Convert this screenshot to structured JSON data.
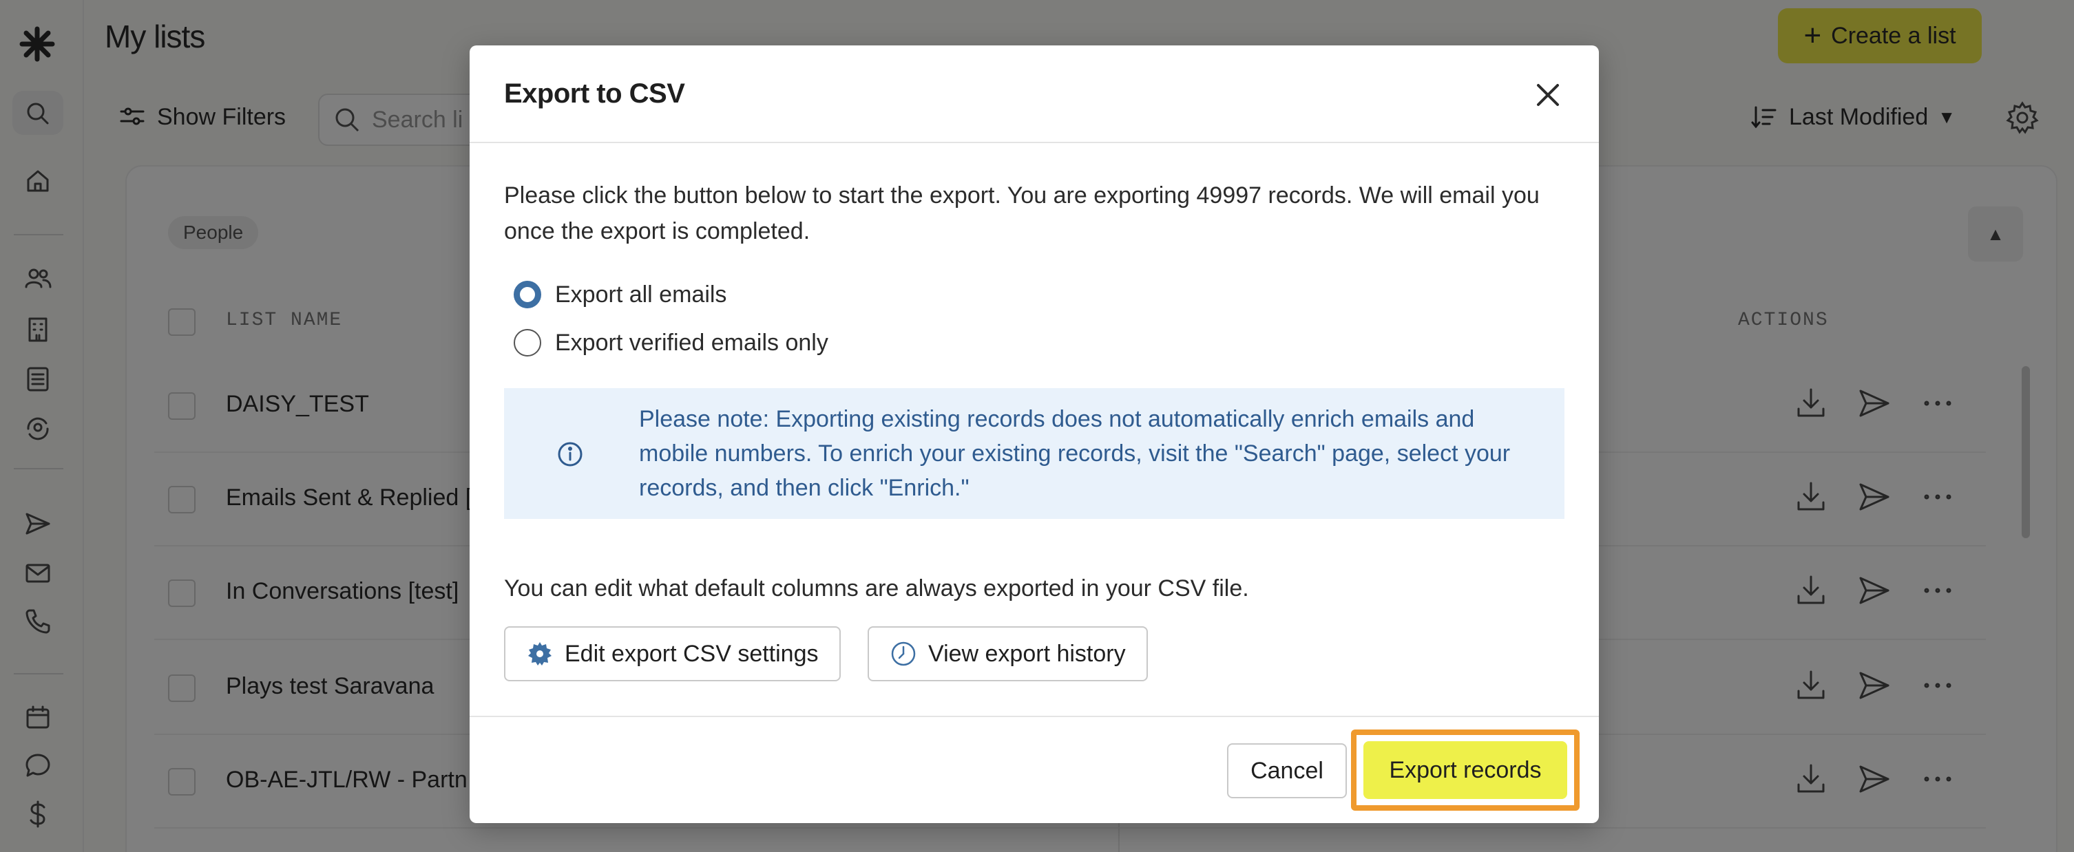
{
  "app": {
    "page_title": "My lists",
    "create_button": "Create a list",
    "show_filters": "Show Filters",
    "search_placeholder": "Search li",
    "sort_label": "Last Modified",
    "chip": "People",
    "columns": {
      "list_name": "LIST NAME",
      "actions": "ACTIONS"
    },
    "rows": [
      {
        "name": "DAISY_TEST"
      },
      {
        "name": "Emails Sent & Replied ["
      },
      {
        "name": "In Conversations [test]"
      },
      {
        "name": "Plays test Saravana"
      },
      {
        "name": "OB-AE-JTL/RW - Partn"
      }
    ]
  },
  "modal": {
    "title": "Export to CSV",
    "intro": "Please click the button below to start the export. You are exporting 49997 records. We will email you once the export is completed.",
    "options": [
      {
        "label": "Export all emails",
        "checked": true
      },
      {
        "label": "Export verified emails only",
        "checked": false
      }
    ],
    "note": "Please note: Exporting existing records does not automatically enrich emails and mobile numbers. To enrich your existing records, visit the \"Search\" page, select your records, and then click \"Enrich.\"",
    "edit_text": "You can edit what default columns are always exported in your CSV file.",
    "edit_settings_button": "Edit export CSV settings",
    "history_button": "View export history",
    "cancel_button": "Cancel",
    "export_button": "Export records"
  },
  "colors": {
    "accent_yellow": "#eef04a",
    "highlight_orange": "#ef9a2e",
    "info_blue": "#2f5b8f",
    "info_bg": "#e9f2fb",
    "radio_blue": "#3d6fa3"
  }
}
